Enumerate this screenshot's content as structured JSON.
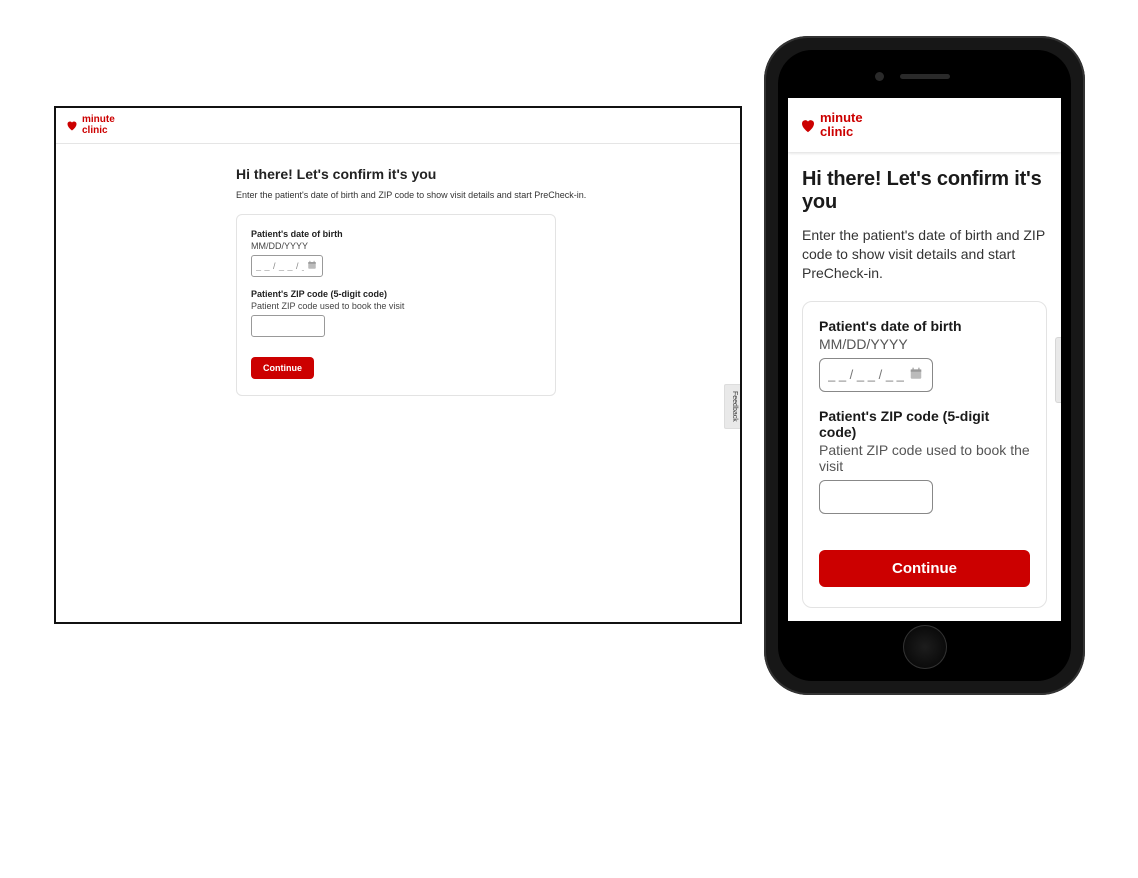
{
  "brand": {
    "name_line1": "minute",
    "name_line2": "clinic",
    "color": "#cc0000"
  },
  "page": {
    "title": "Hi there! Let's confirm it's you",
    "subtitle": "Enter the patient's date of birth and ZIP code to show visit details and start PreCheck-in."
  },
  "form": {
    "dob_label": "Patient's date of birth",
    "dob_hint": "MM/DD/YYYY",
    "dob_placeholder": "_ _ / _ _ / _ _ _ _",
    "zip_label": "Patient's ZIP code (5-digit code)",
    "zip_hint": "Patient ZIP code used to book the visit",
    "zip_value": "",
    "continue_label": "Continue"
  },
  "feedback_tab": "Feedback"
}
